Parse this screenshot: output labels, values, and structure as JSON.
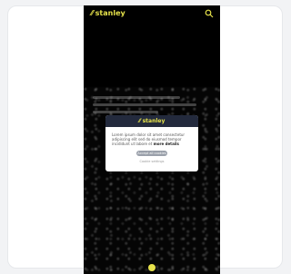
{
  "brand": {
    "name": "stanley"
  },
  "modal": {
    "title": "stanley",
    "body": "Lorem ipsum dolor sit amet consectetur adipiscing elit sed do eiusmod tempor incididunt ut labore et",
    "link_text": "more details",
    "primary_button": "Accept all cookies",
    "secondary_link": "Cookie settings"
  },
  "colors": {
    "brand_yellow": "#e6e24b",
    "header_navy": "#232a3d",
    "page_bg": "#f2f3f5"
  }
}
